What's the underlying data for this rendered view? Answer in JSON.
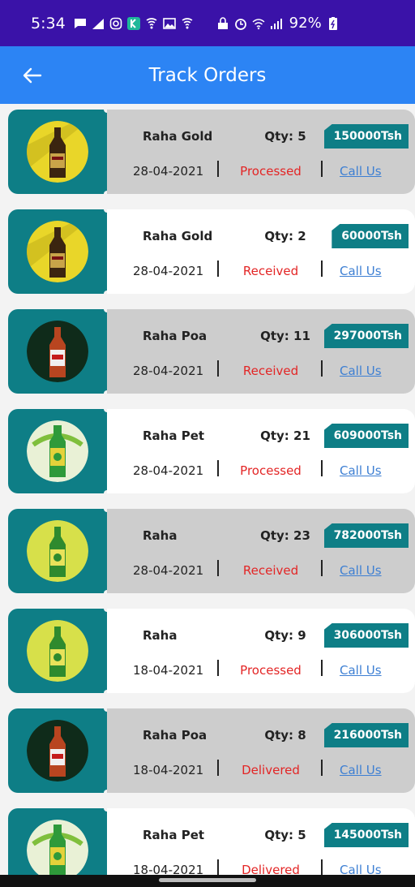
{
  "status_bar": {
    "time": "5:34",
    "battery": "92%",
    "icons_left": [
      "chat-icon",
      "signal-triangle-icon",
      "instagram-icon",
      "k-app-icon",
      "vpn-shield-icon",
      "gallery-icon",
      "vpn-shield-icon"
    ],
    "icons_right": [
      "lock-icon",
      "alarm-icon",
      "wifi-icon",
      "cell-signal-icon",
      "battery-icon"
    ]
  },
  "app_bar": {
    "title": "Track Orders",
    "back_icon": "arrow-left-icon"
  },
  "colors": {
    "status_bar": "#3a12a8",
    "app_bar": "#2c84f4",
    "teal": "#0e7e86",
    "status_red": "#e32525",
    "link_blue": "#3d7fd3"
  },
  "orders": [
    {
      "name": "Raha Gold",
      "qty": "Qty: 5",
      "price": "150000Tsh",
      "date": "28-04-2021",
      "status": "Processed",
      "call": "Call Us",
      "image": "raha-gold-bottle",
      "style": "grey"
    },
    {
      "name": "Raha Gold",
      "qty": "Qty: 2",
      "price": "60000Tsh",
      "date": "28-04-2021",
      "status": "Received",
      "call": "Call Us",
      "image": "raha-gold-bottle",
      "style": "white"
    },
    {
      "name": "Raha Poa",
      "qty": "Qty: 11",
      "price": "297000Tsh",
      "date": "28-04-2021",
      "status": "Received",
      "call": "Call Us",
      "image": "raha-poa-bottle",
      "style": "grey"
    },
    {
      "name": "Raha Pet",
      "qty": "Qty: 21",
      "price": "609000Tsh",
      "date": "28-04-2021",
      "status": "Processed",
      "call": "Call Us",
      "image": "raha-pet-bottle",
      "style": "white"
    },
    {
      "name": "Raha",
      "qty": "Qty: 23",
      "price": "782000Tsh",
      "date": "28-04-2021",
      "status": "Received",
      "call": "Call Us",
      "image": "raha-bottle",
      "style": "grey"
    },
    {
      "name": "Raha",
      "qty": "Qty: 9",
      "price": "306000Tsh",
      "date": "18-04-2021",
      "status": "Processed",
      "call": "Call Us",
      "image": "raha-bottle",
      "style": "white"
    },
    {
      "name": "Raha Poa",
      "qty": "Qty: 8",
      "price": "216000Tsh",
      "date": "18-04-2021",
      "status": "Delivered",
      "call": "Call Us",
      "image": "raha-poa-bottle",
      "style": "grey"
    },
    {
      "name": "Raha Pet",
      "qty": "Qty: 5",
      "price": "145000Tsh",
      "date": "18-04-2021",
      "status": "Delivered",
      "call": "Call Us",
      "image": "raha-pet-bottle",
      "style": "white"
    }
  ]
}
